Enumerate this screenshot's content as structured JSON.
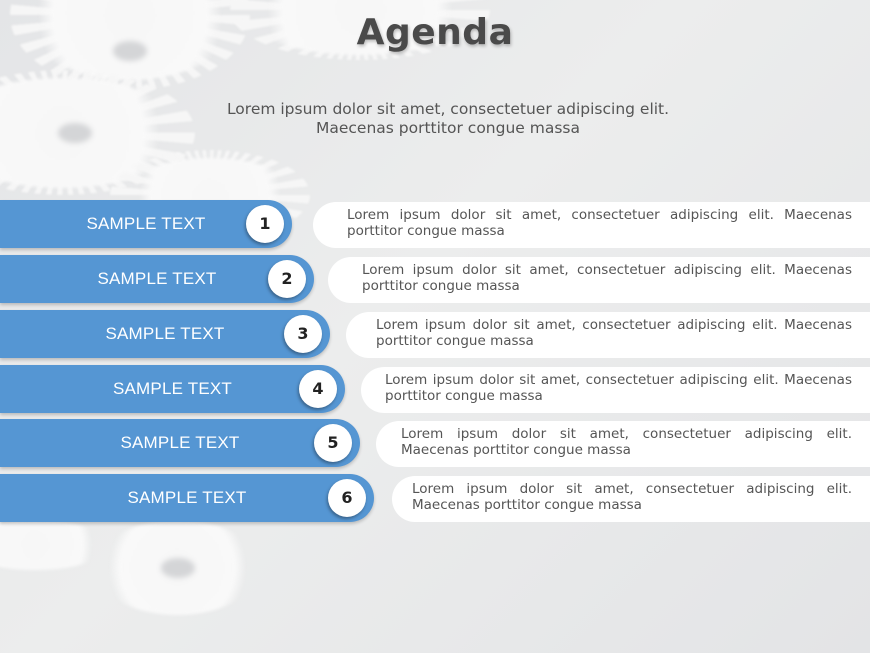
{
  "slide": {
    "title": "Agenda",
    "subtitle_line1": "Lorem ipsum dolor sit amet, consectetuer adipiscing elit.",
    "subtitle_line2": "Maecenas porttitor congue massa",
    "accent_color": "#5596d3",
    "background_icon": "gear-icon"
  },
  "items": [
    {
      "number": "1",
      "label": "SAMPLE TEXT",
      "description": "Lorem ipsum dolor sit amet, consectetuer adipiscing elit. Maecenas porttitor congue massa"
    },
    {
      "number": "2",
      "label": "SAMPLE TEXT",
      "description": "Lorem ipsum dolor sit amet, consectetuer adipiscing elit. Maecenas porttitor congue massa"
    },
    {
      "number": "3",
      "label": "SAMPLE TEXT",
      "description": "Lorem ipsum dolor sit amet, consectetuer adipiscing elit. Maecenas porttitor congue massa"
    },
    {
      "number": "4",
      "label": "SAMPLE TEXT",
      "description": "Lorem ipsum dolor sit amet, consectetuer adipiscing elit. Maecenas porttitor congue massa"
    },
    {
      "number": "5",
      "label": "SAMPLE TEXT",
      "description": "Lorem ipsum dolor sit amet, consectetuer adipiscing elit. Maecenas porttitor congue massa"
    },
    {
      "number": "6",
      "label": "SAMPLE TEXT",
      "description": "Lorem ipsum dolor sit amet, consectetuer adipiscing elit. Maecenas porttitor congue massa"
    }
  ]
}
